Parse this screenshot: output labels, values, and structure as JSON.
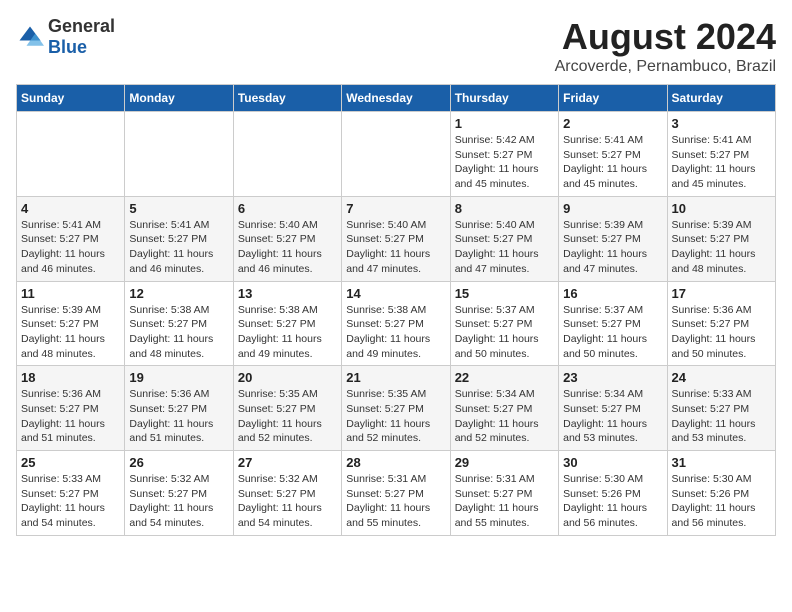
{
  "logo": {
    "general": "General",
    "blue": "Blue"
  },
  "title": "August 2024",
  "subtitle": "Arcoverde, Pernambuco, Brazil",
  "days_of_week": [
    "Sunday",
    "Monday",
    "Tuesday",
    "Wednesday",
    "Thursday",
    "Friday",
    "Saturday"
  ],
  "weeks": [
    [
      {
        "day": "",
        "info": ""
      },
      {
        "day": "",
        "info": ""
      },
      {
        "day": "",
        "info": ""
      },
      {
        "day": "",
        "info": ""
      },
      {
        "day": "1",
        "info": "Sunrise: 5:42 AM\nSunset: 5:27 PM\nDaylight: 11 hours and 45 minutes."
      },
      {
        "day": "2",
        "info": "Sunrise: 5:41 AM\nSunset: 5:27 PM\nDaylight: 11 hours and 45 minutes."
      },
      {
        "day": "3",
        "info": "Sunrise: 5:41 AM\nSunset: 5:27 PM\nDaylight: 11 hours and 45 minutes."
      }
    ],
    [
      {
        "day": "4",
        "info": "Sunrise: 5:41 AM\nSunset: 5:27 PM\nDaylight: 11 hours and 46 minutes."
      },
      {
        "day": "5",
        "info": "Sunrise: 5:41 AM\nSunset: 5:27 PM\nDaylight: 11 hours and 46 minutes."
      },
      {
        "day": "6",
        "info": "Sunrise: 5:40 AM\nSunset: 5:27 PM\nDaylight: 11 hours and 46 minutes."
      },
      {
        "day": "7",
        "info": "Sunrise: 5:40 AM\nSunset: 5:27 PM\nDaylight: 11 hours and 47 minutes."
      },
      {
        "day": "8",
        "info": "Sunrise: 5:40 AM\nSunset: 5:27 PM\nDaylight: 11 hours and 47 minutes."
      },
      {
        "day": "9",
        "info": "Sunrise: 5:39 AM\nSunset: 5:27 PM\nDaylight: 11 hours and 47 minutes."
      },
      {
        "day": "10",
        "info": "Sunrise: 5:39 AM\nSunset: 5:27 PM\nDaylight: 11 hours and 48 minutes."
      }
    ],
    [
      {
        "day": "11",
        "info": "Sunrise: 5:39 AM\nSunset: 5:27 PM\nDaylight: 11 hours and 48 minutes."
      },
      {
        "day": "12",
        "info": "Sunrise: 5:38 AM\nSunset: 5:27 PM\nDaylight: 11 hours and 48 minutes."
      },
      {
        "day": "13",
        "info": "Sunrise: 5:38 AM\nSunset: 5:27 PM\nDaylight: 11 hours and 49 minutes."
      },
      {
        "day": "14",
        "info": "Sunrise: 5:38 AM\nSunset: 5:27 PM\nDaylight: 11 hours and 49 minutes."
      },
      {
        "day": "15",
        "info": "Sunrise: 5:37 AM\nSunset: 5:27 PM\nDaylight: 11 hours and 50 minutes."
      },
      {
        "day": "16",
        "info": "Sunrise: 5:37 AM\nSunset: 5:27 PM\nDaylight: 11 hours and 50 minutes."
      },
      {
        "day": "17",
        "info": "Sunrise: 5:36 AM\nSunset: 5:27 PM\nDaylight: 11 hours and 50 minutes."
      }
    ],
    [
      {
        "day": "18",
        "info": "Sunrise: 5:36 AM\nSunset: 5:27 PM\nDaylight: 11 hours and 51 minutes."
      },
      {
        "day": "19",
        "info": "Sunrise: 5:36 AM\nSunset: 5:27 PM\nDaylight: 11 hours and 51 minutes."
      },
      {
        "day": "20",
        "info": "Sunrise: 5:35 AM\nSunset: 5:27 PM\nDaylight: 11 hours and 52 minutes."
      },
      {
        "day": "21",
        "info": "Sunrise: 5:35 AM\nSunset: 5:27 PM\nDaylight: 11 hours and 52 minutes."
      },
      {
        "day": "22",
        "info": "Sunrise: 5:34 AM\nSunset: 5:27 PM\nDaylight: 11 hours and 52 minutes."
      },
      {
        "day": "23",
        "info": "Sunrise: 5:34 AM\nSunset: 5:27 PM\nDaylight: 11 hours and 53 minutes."
      },
      {
        "day": "24",
        "info": "Sunrise: 5:33 AM\nSunset: 5:27 PM\nDaylight: 11 hours and 53 minutes."
      }
    ],
    [
      {
        "day": "25",
        "info": "Sunrise: 5:33 AM\nSunset: 5:27 PM\nDaylight: 11 hours and 54 minutes."
      },
      {
        "day": "26",
        "info": "Sunrise: 5:32 AM\nSunset: 5:27 PM\nDaylight: 11 hours and 54 minutes."
      },
      {
        "day": "27",
        "info": "Sunrise: 5:32 AM\nSunset: 5:27 PM\nDaylight: 11 hours and 54 minutes."
      },
      {
        "day": "28",
        "info": "Sunrise: 5:31 AM\nSunset: 5:27 PM\nDaylight: 11 hours and 55 minutes."
      },
      {
        "day": "29",
        "info": "Sunrise: 5:31 AM\nSunset: 5:27 PM\nDaylight: 11 hours and 55 minutes."
      },
      {
        "day": "30",
        "info": "Sunrise: 5:30 AM\nSunset: 5:26 PM\nDaylight: 11 hours and 56 minutes."
      },
      {
        "day": "31",
        "info": "Sunrise: 5:30 AM\nSunset: 5:26 PM\nDaylight: 11 hours and 56 minutes."
      }
    ]
  ]
}
